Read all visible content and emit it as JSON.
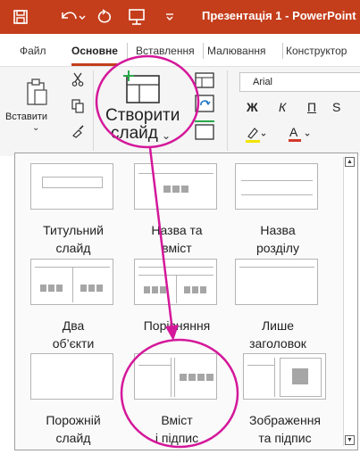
{
  "titlebar": {
    "title": "Презентація 1 - PowerPoint",
    "quick_icons": [
      "save-icon",
      "undo-icon",
      "redo-icon",
      "present-icon",
      "customize-icon"
    ],
    "color": "#c43e1c"
  },
  "tabs": {
    "items": [
      "Файл",
      "Основне",
      "Вставлення",
      "Малювання",
      "Конструктор"
    ],
    "active": "Основне",
    "accent": "#c43e1c"
  },
  "ribbon": {
    "paste_label": "Вставити",
    "new_slide_line1": "Створити",
    "new_slide_line2": "слайд",
    "font_name": "Arial",
    "bold": "Ж",
    "italic": "К",
    "underline": "П",
    "strike": "S",
    "highlight_color": "#f1e400",
    "font_color": "#d23a2a",
    "annotation_color": "#d4189a"
  },
  "layouts": [
    {
      "line1": "Титульний",
      "line2": "слайд"
    },
    {
      "line1": "Назва та",
      "line2": "вміст"
    },
    {
      "line1": "Назва",
      "line2": "розділу"
    },
    {
      "line1": "Два",
      "line2": "об’єкти"
    },
    {
      "line1": "Порівняння",
      "line2": ""
    },
    {
      "line1": "Лише",
      "line2": "заголовок"
    },
    {
      "line1": "Порожній",
      "line2": "слайд"
    },
    {
      "line1": "Вміст",
      "line2": "і підпис"
    },
    {
      "line1": "Зображення",
      "line2": "та підпис"
    }
  ]
}
